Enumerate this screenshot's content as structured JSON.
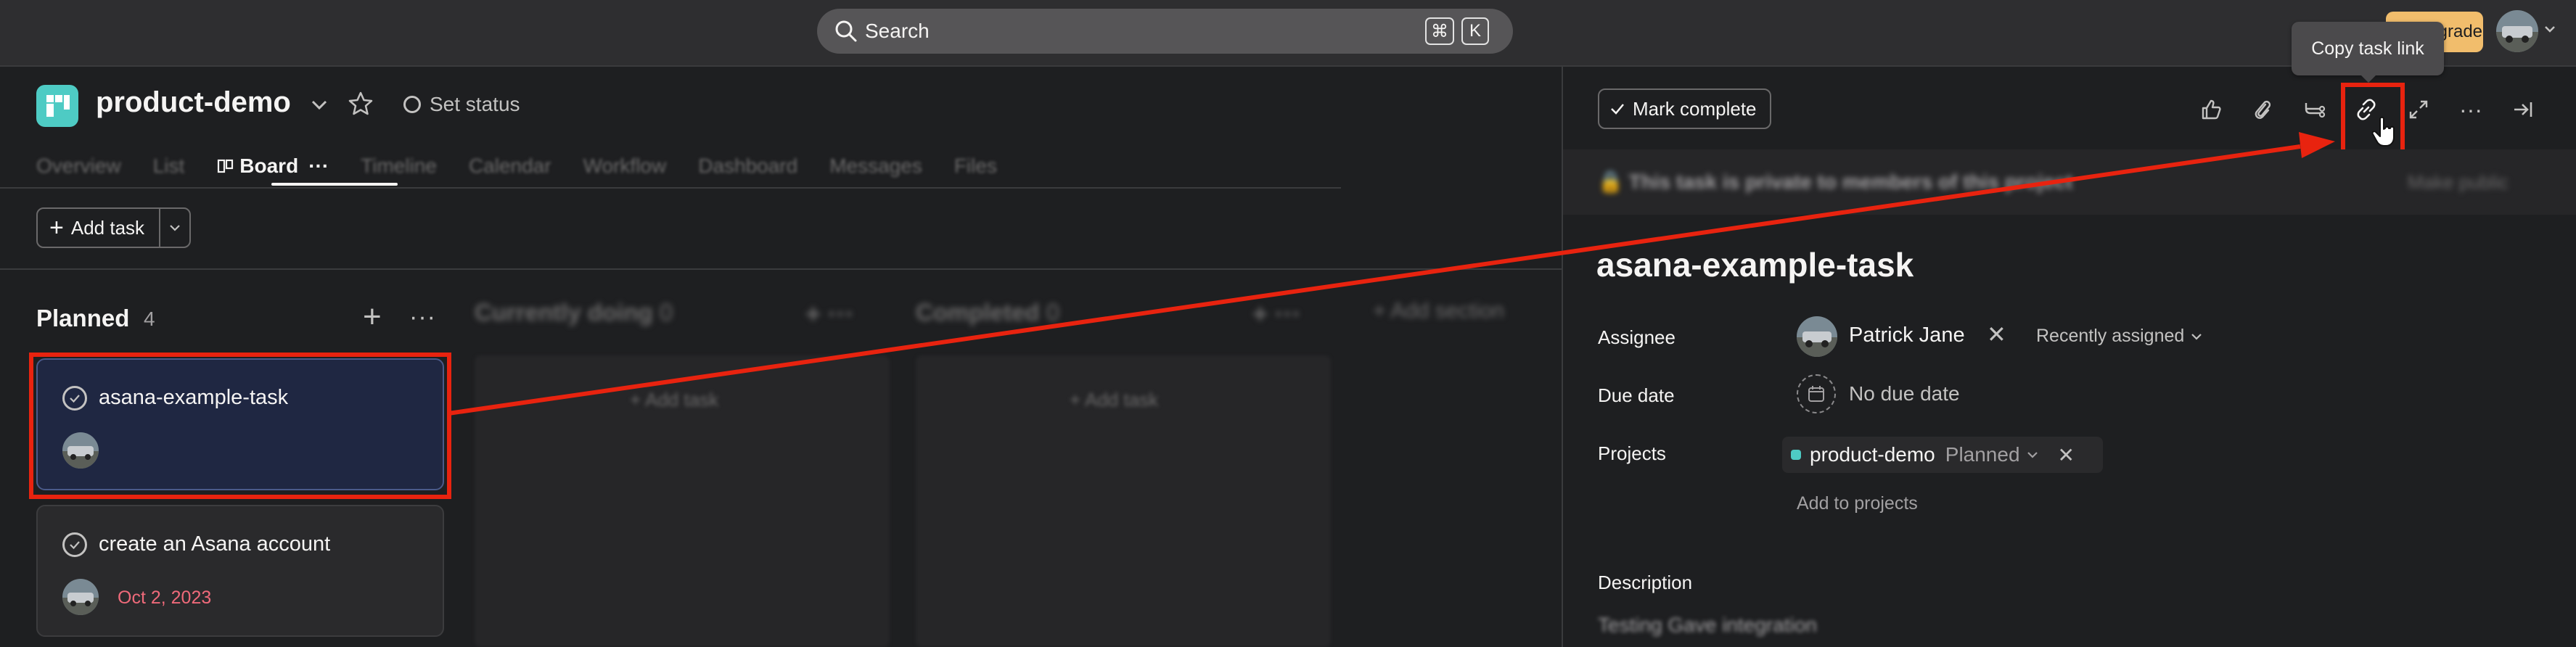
{
  "topbar": {
    "search_label": "Search",
    "shortcut_cmd": "⌘",
    "shortcut_key": "K",
    "upgrade_label": "Upgrade"
  },
  "project": {
    "name": "product-demo",
    "set_status": "Set status",
    "color": "#4ecbc4",
    "tabs": [
      {
        "label": "Overview"
      },
      {
        "label": "List"
      },
      {
        "label": "Board",
        "active": true
      },
      {
        "label": "Timeline"
      },
      {
        "label": "Calendar"
      },
      {
        "label": "Workflow"
      },
      {
        "label": "Dashboard"
      },
      {
        "label": "Messages"
      },
      {
        "label": "Files"
      }
    ]
  },
  "toolbar": {
    "add_task_label": "Add task"
  },
  "board": {
    "columns": [
      {
        "title": "Planned",
        "count": "4"
      },
      {
        "title": "Currently doing",
        "count": "0"
      },
      {
        "title": "Completed",
        "count": "0"
      }
    ],
    "add_section": "Add section",
    "add_task_inline": "Add task",
    "cards": [
      {
        "title": "asana-example-task",
        "due": ""
      },
      {
        "title": "create an Asana account",
        "due": "Oct 2, 2023"
      }
    ]
  },
  "task_pane": {
    "mark_complete_label": "Mark complete",
    "tooltip": "Copy task link",
    "private_banner": "This task is private to members of this project",
    "make_public": "Make public",
    "title": "asana-example-task",
    "fields": {
      "assignee_label": "Assignee",
      "assignee_name": "Patrick Jane",
      "recently_assigned": "Recently assigned",
      "due_date_label": "Due date",
      "due_date_value": "No due date",
      "projects_label": "Projects",
      "project_name": "product-demo",
      "project_section": "Planned",
      "add_to_projects": "Add to projects",
      "description_label": "Description",
      "description_value": "Testing Gave integration"
    }
  },
  "annotation": {
    "color": "#e8230f"
  }
}
